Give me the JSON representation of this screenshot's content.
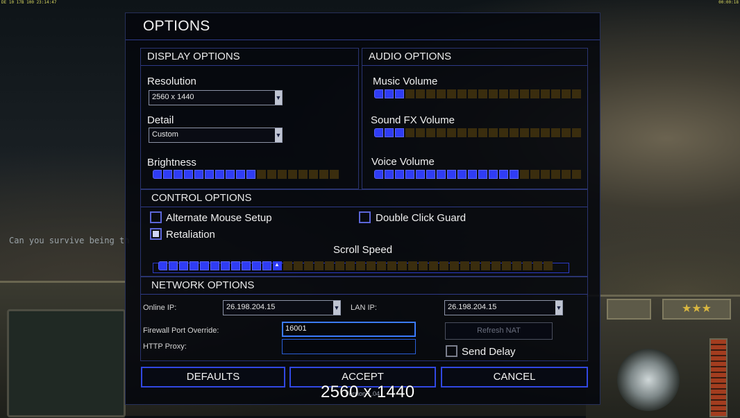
{
  "hud": {
    "topbar_left": "DE 10 17B 100 23:14:47",
    "topbar_right": "00:00:18",
    "chat_line": "Can you survive being th",
    "stars": "★★★"
  },
  "options": {
    "title": "OPTIONS",
    "display": {
      "header": "DISPLAY OPTIONS",
      "resolution_label": "Resolution",
      "resolution_value": "2560 x 1440",
      "detail_label": "Detail",
      "detail_value": "Custom",
      "brightness_label": "Brightness",
      "brightness_level": 0.54
    },
    "audio": {
      "header": "AUDIO OPTIONS",
      "music_label": "Music Volume",
      "music_level": 0.15,
      "sfx_label": "Sound FX Volume",
      "sfx_level": 0.15,
      "voice_label": "Voice Volume",
      "voice_level": 0.7
    },
    "control": {
      "header": "CONTROL OPTIONS",
      "alt_mouse_label": "Alternate Mouse Setup",
      "alt_mouse_checked": false,
      "double_click_label": "Double Click Guard",
      "double_click_checked": false,
      "retaliation_label": "Retaliation",
      "retaliation_checked": true,
      "scroll_label": "Scroll Speed",
      "scroll_level": 0.29
    },
    "network": {
      "header": "NETWORK OPTIONS",
      "online_ip_label": "Online IP:",
      "online_ip_value": "26.198.204.15",
      "lan_ip_label": "LAN IP:",
      "lan_ip_value": "26.198.204.15",
      "firewall_label": "Firewall Port Override:",
      "firewall_value": "16001",
      "proxy_label": "HTTP Proxy:",
      "proxy_value": "",
      "refresh_nat_label": "Refresh NAT",
      "send_delay_label": "Send Delay",
      "send_delay_checked": false
    },
    "buttons": {
      "defaults": "DEFAULTS",
      "accept": "ACCEPT",
      "cancel": "CANCEL"
    }
  },
  "overlay": {
    "resolution_text": "2560 x 1440",
    "version_text": "Version 1.04"
  }
}
